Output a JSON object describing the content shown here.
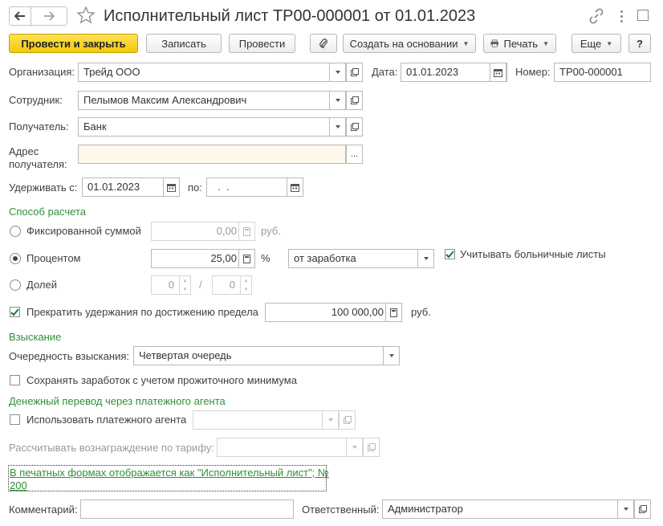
{
  "title": "Исполнительный лист ТР00-000001 от 01.01.2023",
  "toolbar": {
    "post_close": "Провести и закрыть",
    "save": "Записать",
    "post": "Провести",
    "create_based": "Создать на основании",
    "print": "Печать",
    "more": "Еще",
    "help": "?"
  },
  "org": {
    "label": "Организация:",
    "value": "Трейд ООО"
  },
  "date": {
    "label": "Дата:",
    "value": "01.01.2023"
  },
  "number": {
    "label": "Номер:",
    "value": "ТР00-000001"
  },
  "employee": {
    "label": "Сотрудник:",
    "value": "Пелымов Максим Александрович"
  },
  "recipient": {
    "label": "Получатель:",
    "value": "Банк"
  },
  "address": {
    "label_line1": "Адрес",
    "label_line2": "получателя:",
    "value": ""
  },
  "withhold": {
    "from_label": "Удерживать с:",
    "from_value": "01.01.2023",
    "to_label": "по:",
    "to_value": "  .  ."
  },
  "calc": {
    "section": "Способ расчета",
    "fixed_label": "Фиксированной суммой",
    "fixed_value": "0,00",
    "fixed_unit": "руб.",
    "percent_label": "Процентом",
    "percent_value": "25,00",
    "percent_unit": "%",
    "percent_base": "от заработка",
    "sick_label": "Учитывать больничные листы",
    "share_label": "Долей",
    "share_num": "0",
    "share_sep": "/",
    "share_den": "0",
    "limit_label": "Прекратить удержания по достижению предела",
    "limit_value": "100 000,00",
    "limit_unit": "руб."
  },
  "collection": {
    "section": "Взыскание",
    "order_label": "Очередность взыскания:",
    "order_value": "Четвертая очередь",
    "keep_label": "Сохранять заработок с учетом прожиточного минимума"
  },
  "transfer": {
    "section": "Денежный перевод через платежного агента",
    "use_agent_label": "Использовать платежного агента",
    "agent_value": "",
    "fee_label": "Рассчитывать вознаграждение по тарифу:",
    "fee_value": ""
  },
  "print_link": {
    "line1": "В печатных формах отображается как \"Исполнительный лист\"; №",
    "line2": "200"
  },
  "comment": {
    "label": "Комментарий:",
    "value": ""
  },
  "responsible": {
    "label": "Ответственный:",
    "value": "Администратор"
  },
  "colors": {
    "accent": "#f2c80c",
    "section": "#2f8f3a"
  }
}
